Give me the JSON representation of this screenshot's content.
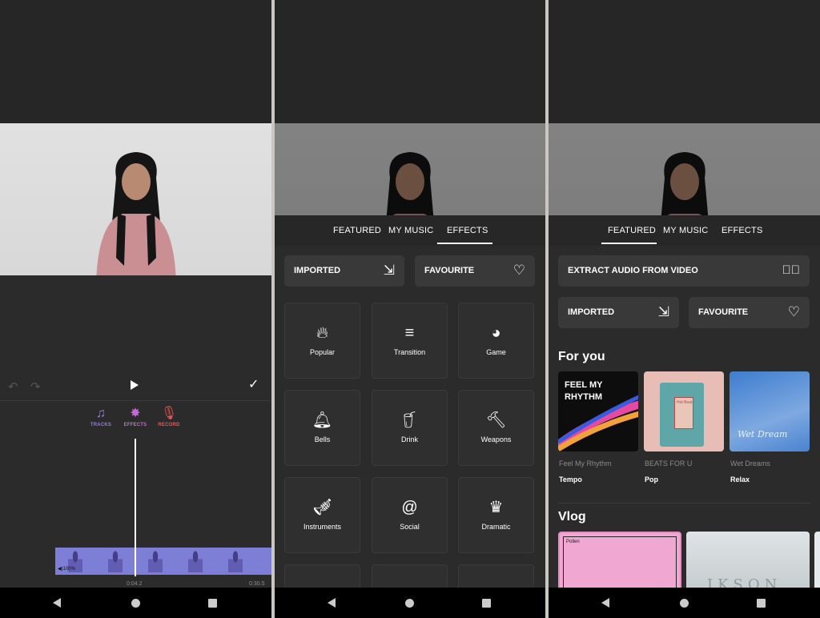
{
  "editor": {
    "undo_icon": "undo-icon",
    "redo_icon": "redo-icon",
    "play_icon": "play-icon",
    "check_icon": "check-icon",
    "tools": [
      {
        "label": "TRACKS",
        "icon": "music-note-plus-icon",
        "color": "#9b7be0"
      },
      {
        "label": "EFFECTS",
        "icon": "sparkle-icon",
        "color": "#c46ad7"
      },
      {
        "label": "RECORD",
        "icon": "microphone-icon",
        "color": "#e05a5a"
      }
    ],
    "clip_volume": "◀)100%",
    "time_current": "0:04.2",
    "time_total": "0:30.5"
  },
  "music_effects": {
    "tabs": [
      "FEATURED",
      "MY MUSIC",
      "EFFECTS"
    ],
    "active_tab": "EFFECTS",
    "imported_label": "IMPORTED",
    "favourite_label": "FAVOURITE",
    "categories": [
      {
        "label": "Popular",
        "icon": "flame-icon"
      },
      {
        "label": "Transition",
        "icon": "swoosh-icon"
      },
      {
        "label": "Game",
        "icon": "pacman-icon"
      },
      {
        "label": "Bells",
        "icon": "bell-icon"
      },
      {
        "label": "Drink",
        "icon": "cup-icon"
      },
      {
        "label": "Weapons",
        "icon": "hammer-icon"
      },
      {
        "label": "Instruments",
        "icon": "trumpet-icon"
      },
      {
        "label": "Social",
        "icon": "at-icon"
      },
      {
        "label": "Dramatic",
        "icon": "jester-icon"
      }
    ]
  },
  "music_featured": {
    "tabs": [
      "FEATURED",
      "MY MUSIC",
      "EFFECTS"
    ],
    "active_tab": "FEATURED",
    "extract_label": "EXTRACT AUDIO FROM VIDEO",
    "imported_label": "IMPORTED",
    "favourite_label": "FAVOURITE",
    "for_you_title": "For you",
    "albums": [
      {
        "name": "Feel My Rhythm",
        "genre": "Tempo",
        "cover_text": "FEEL MY RHYTHM"
      },
      {
        "name": "BEATS FOR U",
        "genre": "Pop",
        "cover_text": "Hot Beat"
      },
      {
        "name": "Wet Dreams",
        "genre": "Relax",
        "cover_text": "Wet Dream"
      }
    ],
    "vlog_title": "Vlog",
    "vlog_albums": [
      {
        "cover_text": "Pollen"
      },
      {
        "cover_text": "IKSON"
      }
    ]
  },
  "colors": {
    "background": "#2b2b2b",
    "card": "#393939",
    "clip": "#7d7fd6"
  }
}
